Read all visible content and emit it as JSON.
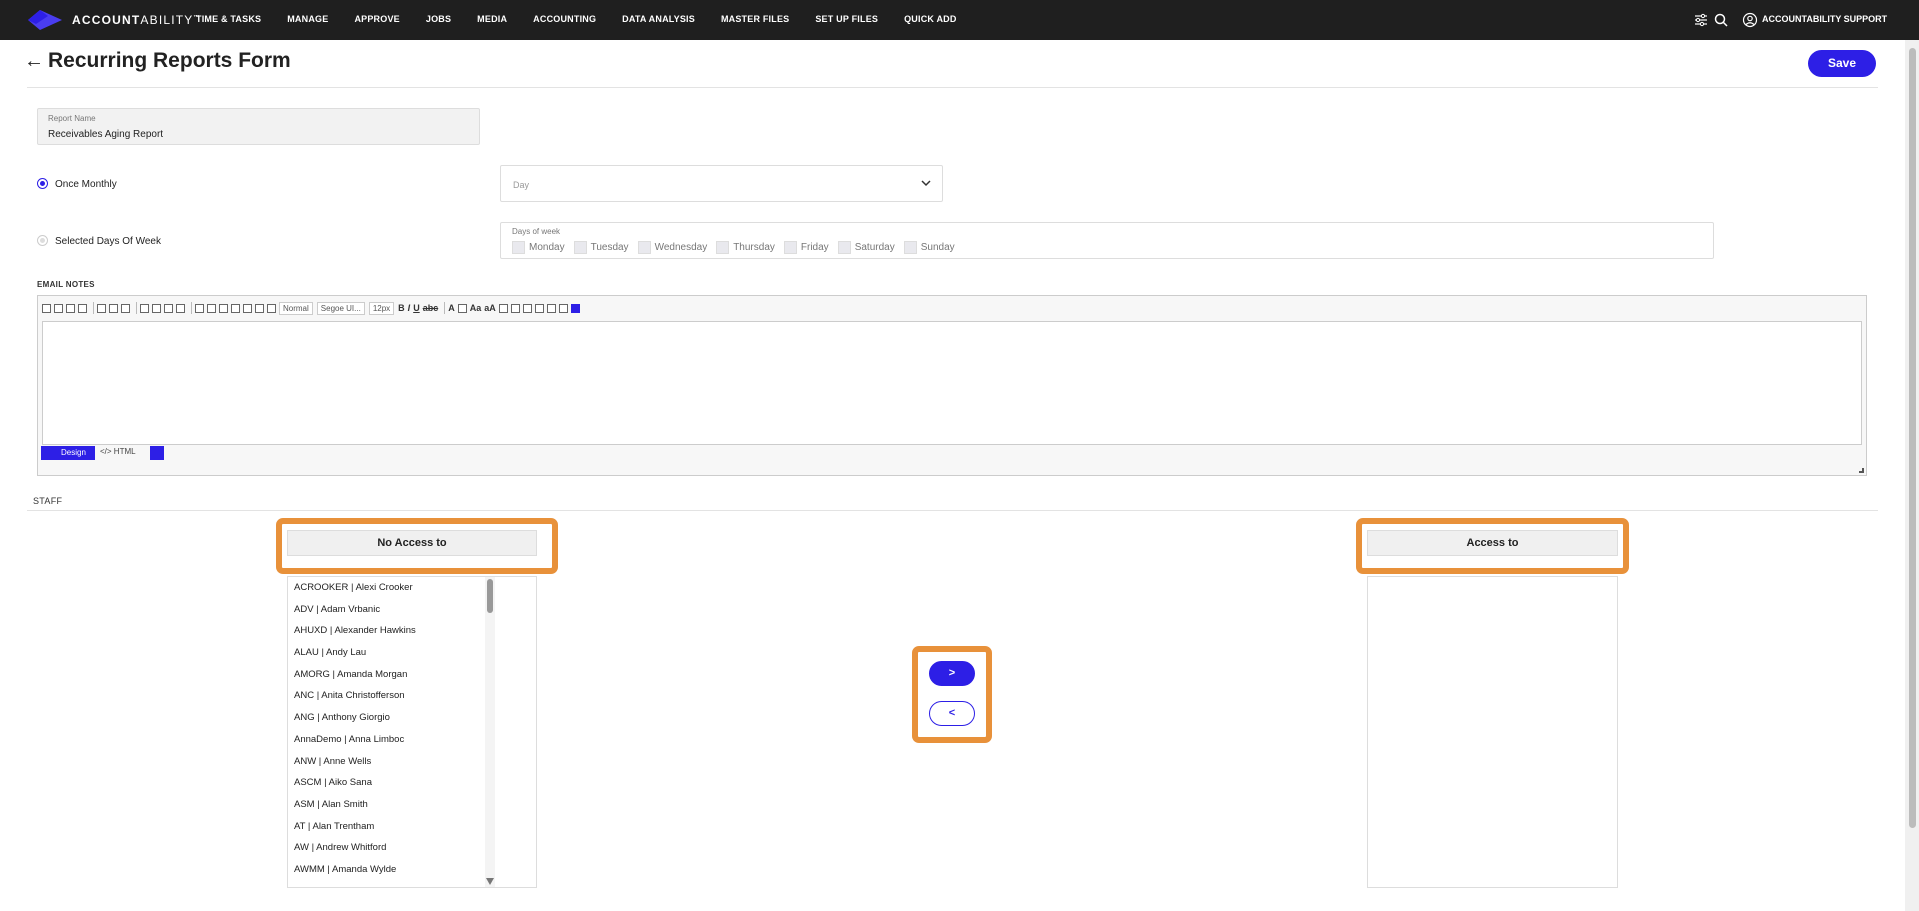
{
  "header": {
    "brand_main": "ACCOUNT",
    "brand_tail": "ABILITY",
    "brand_mark": "™",
    "nav": [
      "TIME & TASKS",
      "MANAGE",
      "APPROVE",
      "JOBS",
      "MEDIA",
      "ACCOUNTING",
      "DATA ANALYSIS",
      "MASTER FILES",
      "SET UP FILES",
      "QUICK ADD"
    ],
    "user": "ACCOUNTABILITY SUPPORT",
    "icons": [
      "sliders-icon",
      "search-icon",
      "user-icon"
    ]
  },
  "page": {
    "title": "Recurring Reports Form",
    "save_label": "Save"
  },
  "form": {
    "report_name_label": "Report Name",
    "report_name_value": "Receivables Aging Report",
    "once_monthly_label": "Once Monthly",
    "day_placeholder": "Day",
    "selected_days_label": "Selected Days Of Week",
    "days_of_week_label": "Days of week",
    "days": [
      "Monday",
      "Tuesday",
      "Wednesday",
      "Thursday",
      "Friday",
      "Saturday",
      "Sunday"
    ],
    "email_notes_label": "EMAIL NOTES"
  },
  "editor": {
    "format_select": "Normal",
    "font_select": "Segoe UI...",
    "size_select": "12px",
    "design_tab": "Design",
    "html_tab": "HTML"
  },
  "staff": {
    "section_label": "STAFF",
    "no_access_header": "No Access to",
    "access_header": "Access to",
    "move_right": ">",
    "move_left": "<",
    "no_access": [
      "ACROOKER | Alexi Crooker",
      "ADV | Adam Vrbanic",
      "AHUXD | Alexander Hawkins",
      "ALAU | Andy Lau",
      "AMORG | Amanda Morgan",
      "ANC | Anita Christofferson",
      "ANG | Anthony Giorgio",
      "AnnaDemo | Anna Limboc",
      "ANW | Anne Wells",
      "ASCM | Aiko Sana",
      "ASM | Alan Smith",
      "AT | Alan Trentham",
      "AW | Andrew Whitford",
      "AWMM | Amanda Wylde"
    ]
  },
  "colors": {
    "accent": "#2d1fe6",
    "highlight": "#e8913a",
    "topbar": "#1f1f1f"
  }
}
